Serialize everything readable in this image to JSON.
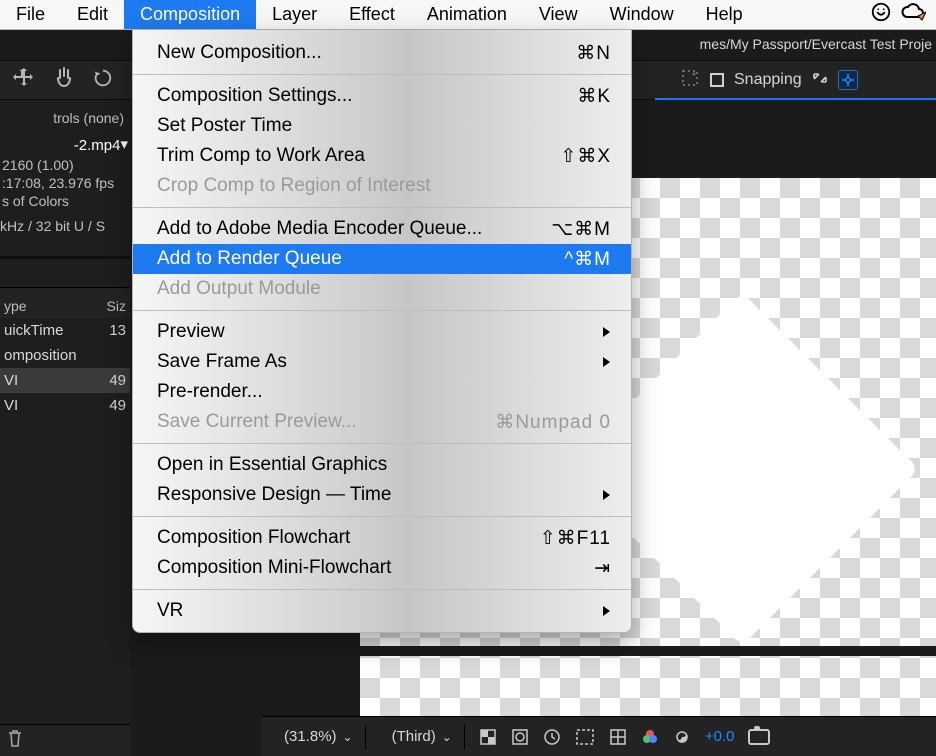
{
  "menubar": {
    "items": [
      "File",
      "Edit",
      "Composition",
      "Layer",
      "Effect",
      "Animation",
      "View",
      "Window",
      "Help"
    ],
    "active_index": 2
  },
  "app": {
    "title_fragment": "mes/My Passport/Evercast Test Proje",
    "snapping_label": "Snapping"
  },
  "leftpanel": {
    "effect_controls_label": "trols (none)",
    "comp_name": "-2.mp4",
    "comp_res": "2160 (1.00)",
    "comp_dur": ":17:08, 23.976 fps",
    "color_label": "s of Colors",
    "audio_format": "kHz / 32 bit U / S",
    "header_type": "ype",
    "header_size": "Siz",
    "rows": [
      {
        "type": "uickTime",
        "size": "13"
      },
      {
        "type": "omposition",
        "size": ""
      },
      {
        "type": "VI",
        "size": "49"
      },
      {
        "type": "VI",
        "size": "49"
      }
    ]
  },
  "menu": {
    "groups": [
      [
        {
          "label": "New Composition...",
          "shortcut": "⌘N",
          "disabled": false
        }
      ],
      [
        {
          "label": "Composition Settings...",
          "shortcut": "⌘K",
          "disabled": false
        },
        {
          "label": "Set Poster Time",
          "shortcut": "",
          "disabled": false
        },
        {
          "label": "Trim Comp to Work Area",
          "shortcut": "⇧⌘X",
          "disabled": false
        },
        {
          "label": "Crop Comp to Region of Interest",
          "shortcut": "",
          "disabled": true
        }
      ],
      [
        {
          "label": "Add to Adobe Media Encoder Queue...",
          "shortcut": "⌥⌘M",
          "disabled": false
        },
        {
          "label": "Add to Render Queue",
          "shortcut": "^⌘M",
          "disabled": false,
          "highlight": true
        },
        {
          "label": "Add Output Module",
          "shortcut": "",
          "disabled": true
        }
      ],
      [
        {
          "label": "Preview",
          "shortcut": "",
          "disabled": false,
          "sub": true
        },
        {
          "label": "Save Frame As",
          "shortcut": "",
          "disabled": false,
          "sub": true
        },
        {
          "label": "Pre-render...",
          "shortcut": "",
          "disabled": false
        },
        {
          "label": "Save Current Preview...",
          "shortcut": "⌘Numpad 0",
          "disabled": true
        }
      ],
      [
        {
          "label": "Open in Essential Graphics",
          "shortcut": "",
          "disabled": false
        },
        {
          "label": "Responsive Design — Time",
          "shortcut": "",
          "disabled": false,
          "sub": true
        }
      ],
      [
        {
          "label": "Composition Flowchart",
          "shortcut": "⇧⌘F11",
          "disabled": false
        },
        {
          "label": "Composition Mini-Flowchart",
          "shortcut": "⇥",
          "disabled": false
        }
      ],
      [
        {
          "label": "VR",
          "shortcut": "",
          "disabled": false,
          "sub": true
        }
      ]
    ]
  },
  "footer": {
    "zoom": "(31.8%)",
    "quality": "(Third)",
    "timecode": "+0.0"
  }
}
